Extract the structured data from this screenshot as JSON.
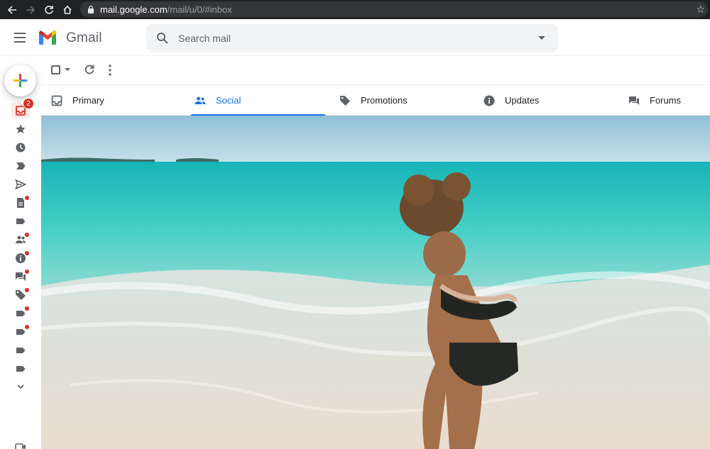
{
  "browser": {
    "url_host": "mail.google.com",
    "url_path": "/mail/u/0/#inbox"
  },
  "app": {
    "brand": "Gmail"
  },
  "search": {
    "placeholder": "Search mail"
  },
  "rail": {
    "inbox_badge": "2"
  },
  "tabs": [
    {
      "label": "Primary",
      "icon": "inbox-icon",
      "active": false
    },
    {
      "label": "Social",
      "icon": "people-icon",
      "active": true
    },
    {
      "label": "Promotions",
      "icon": "tag-icon",
      "active": false
    },
    {
      "label": "Updates",
      "icon": "info-icon",
      "active": false
    },
    {
      "label": "Forums",
      "icon": "forum-icon",
      "active": false
    }
  ],
  "colors": {
    "accent": "#1a73e8",
    "badge": "#d93025",
    "sea": "#2ec3bf",
    "sky": "#a7cfe0"
  }
}
